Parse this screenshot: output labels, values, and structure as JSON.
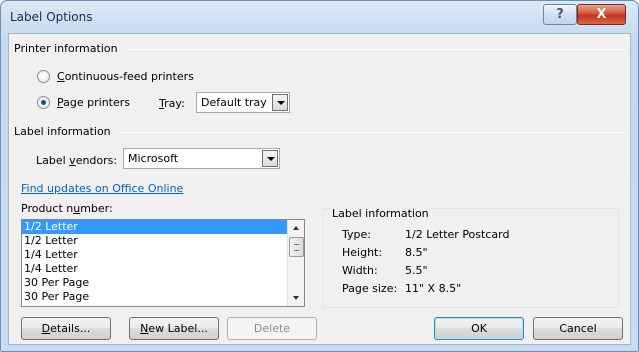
{
  "window": {
    "title": "Label Options",
    "help_glyph": "?",
    "close_glyph": "X"
  },
  "printer_info": {
    "group_label": "Printer information",
    "continuous_option": {
      "pre": "",
      "accel": "C",
      "post": "ontinuous-feed printers",
      "checked": false
    },
    "page_option": {
      "pre": "",
      "accel": "P",
      "post": "age printers",
      "checked": true
    },
    "tray_label": {
      "pre": "",
      "accel": "T",
      "post": "ray:"
    },
    "tray_value": "Default tray"
  },
  "label_info": {
    "group_label": "Label information",
    "vendors_label": {
      "pre": "Label ",
      "accel": "v",
      "post": "endors:"
    },
    "vendors_value": "Microsoft"
  },
  "find_updates_link": "Find updates on Office Online",
  "product_number": {
    "label": {
      "pre": "Product n",
      "accel": "u",
      "post": "mber:"
    },
    "items": [
      "1/2 Letter",
      "1/2 Letter",
      "1/4 Letter",
      "1/4 Letter",
      "30 Per Page",
      "30 Per Page"
    ],
    "selected_index": 0
  },
  "label_details": {
    "group_label": "Label information",
    "rows": [
      {
        "key": "Type:",
        "value": "1/2 Letter Postcard"
      },
      {
        "key": "Height:",
        "value": "8.5\""
      },
      {
        "key": "Width:",
        "value": "5.5\""
      },
      {
        "key": "Page size:",
        "value": "11\" X 8.5\""
      }
    ]
  },
  "buttons": {
    "details": {
      "pre": "",
      "accel": "D",
      "post": "etails..."
    },
    "new_label": {
      "pre": "",
      "accel": "N",
      "post": "ew Label..."
    },
    "delete": "Delete",
    "ok": "OK",
    "cancel": "Cancel"
  },
  "colors": {
    "link": "#0066cc",
    "selection": "#3399ff",
    "close_button": "#c3331a"
  }
}
